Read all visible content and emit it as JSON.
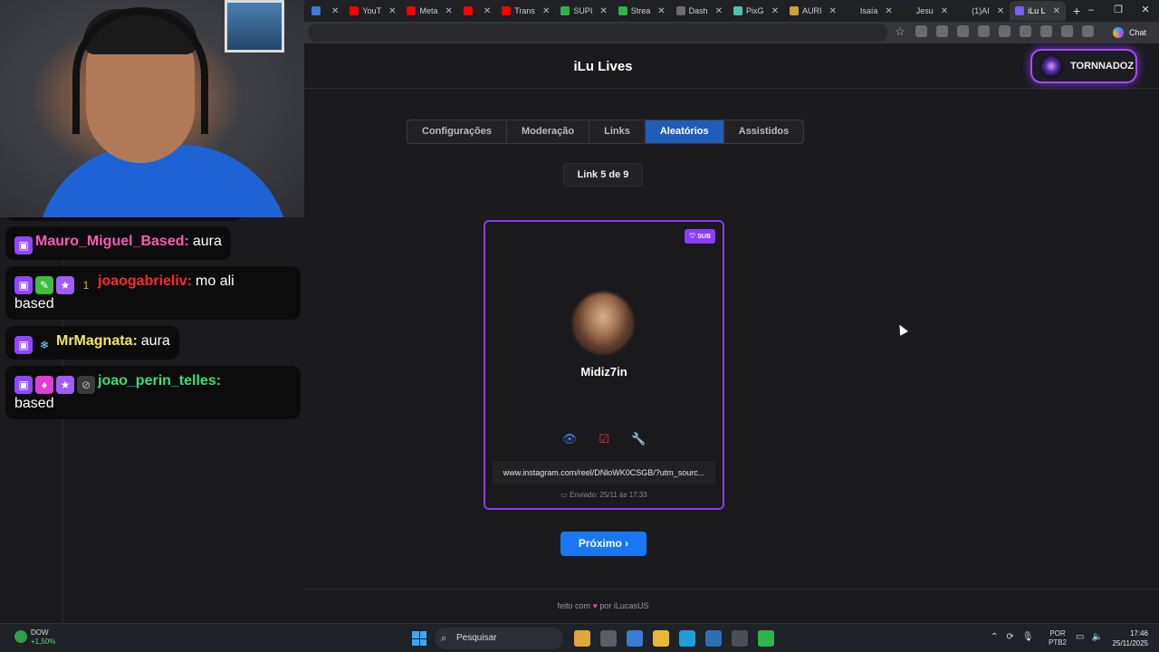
{
  "browser": {
    "tabs": [
      {
        "label": "",
        "color": "#3a7bd5"
      },
      {
        "label": "YouT",
        "color": "#ff0000"
      },
      {
        "label": "Meta",
        "color": "#ff0000"
      },
      {
        "label": "",
        "color": "#ff0000"
      },
      {
        "label": "Trans",
        "color": "#ff0000"
      },
      {
        "label": "SUPI",
        "color": "#2fb34a"
      },
      {
        "label": "Strea",
        "color": "#2fb34a"
      },
      {
        "label": "Dash",
        "color": "#6a6a70"
      },
      {
        "label": "PixG",
        "color": "#4ec3b0"
      },
      {
        "label": "AURI",
        "color": "#c9a13a"
      },
      {
        "label": "Isaía",
        "color": "#222222"
      },
      {
        "label": "Jesu",
        "color": "#222222"
      },
      {
        "label": "(1)AI",
        "color": "#222222"
      },
      {
        "label": "iLu L",
        "color": "#7a5cff",
        "active": true
      }
    ],
    "new_tab": "+",
    "chat_label": "Chat"
  },
  "chat": {
    "messages": [
      {
        "user": "Mauro_Miguel_Based:",
        "text": "aura",
        "user_color": "#ff5ab4",
        "badges": [
          "twitch"
        ]
      },
      {
        "user": "joaogabrieliv:",
        "text": "mo ali",
        "text2": "based",
        "user_color": "#ff2a2a",
        "badges": [
          "twitch",
          "green",
          "star",
          "gold"
        ],
        "gold_badge": "1"
      },
      {
        "user": "MrMagnata:",
        "text": "aura",
        "user_color": "#f2e85a",
        "badges": [
          "twitch",
          "snow"
        ]
      },
      {
        "user": "joao_perin_telles:",
        "text": "",
        "text2": "based",
        "user_color": "#33e07a",
        "badges": [
          "twitch",
          "gem",
          "star",
          "hide"
        ]
      }
    ]
  },
  "header": {
    "title": "iLu Lives",
    "username": "TORNNADOZ"
  },
  "nav": {
    "tabs": [
      "Configurações",
      "Moderação",
      "Links",
      "Aleatórios",
      "Assistidos"
    ],
    "active": "Aleatórios"
  },
  "counter": "Link 5 de 9",
  "card": {
    "badge": "SUB",
    "username": "Midiz7in",
    "link": "www.instagram.com/reel/DNloWK0CSGB/?utm_sourc...",
    "sent": "Enviado: 25/11 às 17:33",
    "icons": [
      "eye-icon",
      "check-square-icon",
      "wrench-icon"
    ]
  },
  "next_button": "Próximo ›",
  "footer": {
    "prefix": "feito com",
    "suffix": "por iLucasUS"
  },
  "taskbar": {
    "widget_label": "DOW",
    "widget_change": "+1,50%",
    "search_placeholder": "Pesquisar",
    "lang1": "POR",
    "lang2": "PTB2",
    "time": "17:46",
    "date": "25/11/2025"
  },
  "colors": {
    "accent": "#1877f2",
    "card_border": "#8a3cff",
    "active_tab": "#1f5db8"
  }
}
